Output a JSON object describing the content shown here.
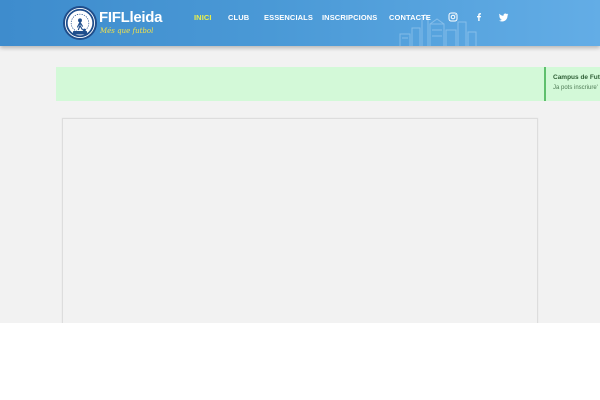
{
  "brand": {
    "name": "FIFLleida",
    "slogan": "Més que futbol"
  },
  "nav": {
    "items": [
      {
        "label": "INICI",
        "active": true
      },
      {
        "label": "CLUB",
        "active": false
      },
      {
        "label": "ESSENCIALS",
        "active": false
      },
      {
        "label": "INSCRIPCIONS",
        "active": false
      },
      {
        "label": "CONTACTE",
        "active": false
      }
    ],
    "social": [
      "instagram-icon",
      "facebook-icon",
      "twitter-icon"
    ]
  },
  "notice": {
    "title": "Campus de Fut",
    "text": "Ja pots inscriure'"
  },
  "colors": {
    "header_start": "#3e8ccd",
    "header_end": "#63ade6",
    "nav_active": "#ecf04a",
    "notice_bg": "#d3f9d8",
    "notice_accent": "#5ec06d",
    "page_bg": "#f2f2f2"
  }
}
